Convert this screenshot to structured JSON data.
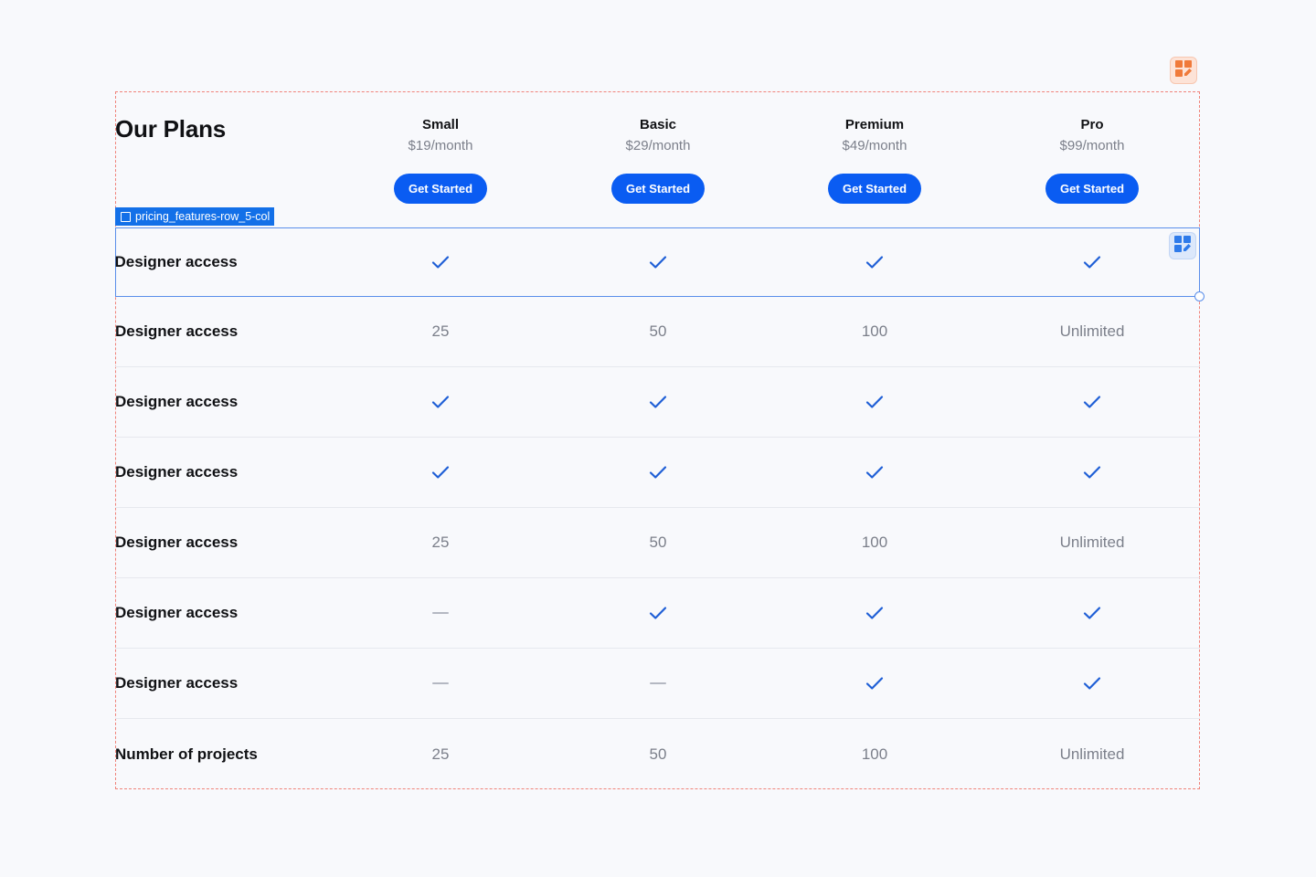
{
  "header": {
    "title": "Our Plans"
  },
  "component_tag": "pricing_features-row_5-col",
  "plans": [
    {
      "name": "Small",
      "price": "$19/month",
      "cta": "Get Started"
    },
    {
      "name": "Basic",
      "price": "$29/month",
      "cta": "Get Started"
    },
    {
      "name": "Premium",
      "price": "$49/month",
      "cta": "Get Started"
    },
    {
      "name": "Pro",
      "price": "$99/month",
      "cta": "Get Started"
    }
  ],
  "rows": [
    {
      "label": "Designer access",
      "cells": [
        "check",
        "check",
        "check",
        "check"
      ],
      "selected": true
    },
    {
      "label": "Designer access",
      "cells": [
        "25",
        "50",
        "100",
        "Unlimited"
      ]
    },
    {
      "label": "Designer access",
      "cells": [
        "check",
        "check",
        "check",
        "check"
      ]
    },
    {
      "label": "Designer access",
      "cells": [
        "check",
        "check",
        "check",
        "check"
      ]
    },
    {
      "label": "Designer access",
      "cells": [
        "25",
        "50",
        "100",
        "Unlimited"
      ]
    },
    {
      "label": "Designer access",
      "cells": [
        "dash",
        "check",
        "check",
        "check"
      ]
    },
    {
      "label": "Designer access",
      "cells": [
        "dash",
        "dash",
        "check",
        "check"
      ]
    },
    {
      "label": "Number of projects",
      "cells": [
        "25",
        "50",
        "100",
        "Unlimited"
      ]
    }
  ],
  "colors": {
    "accent": "#0a5cf2",
    "check": "#1f5fd6",
    "muted_text": "#7b7f8a",
    "frame_dashed": "#f0837a",
    "selection": "#5a8eea",
    "tag_bg": "#1370e8"
  },
  "icons": {
    "edit_badge_top": "grid-edit-icon",
    "edit_badge_row": "grid-edit-icon",
    "check": "checkmark-icon",
    "dash": "dash-icon"
  }
}
